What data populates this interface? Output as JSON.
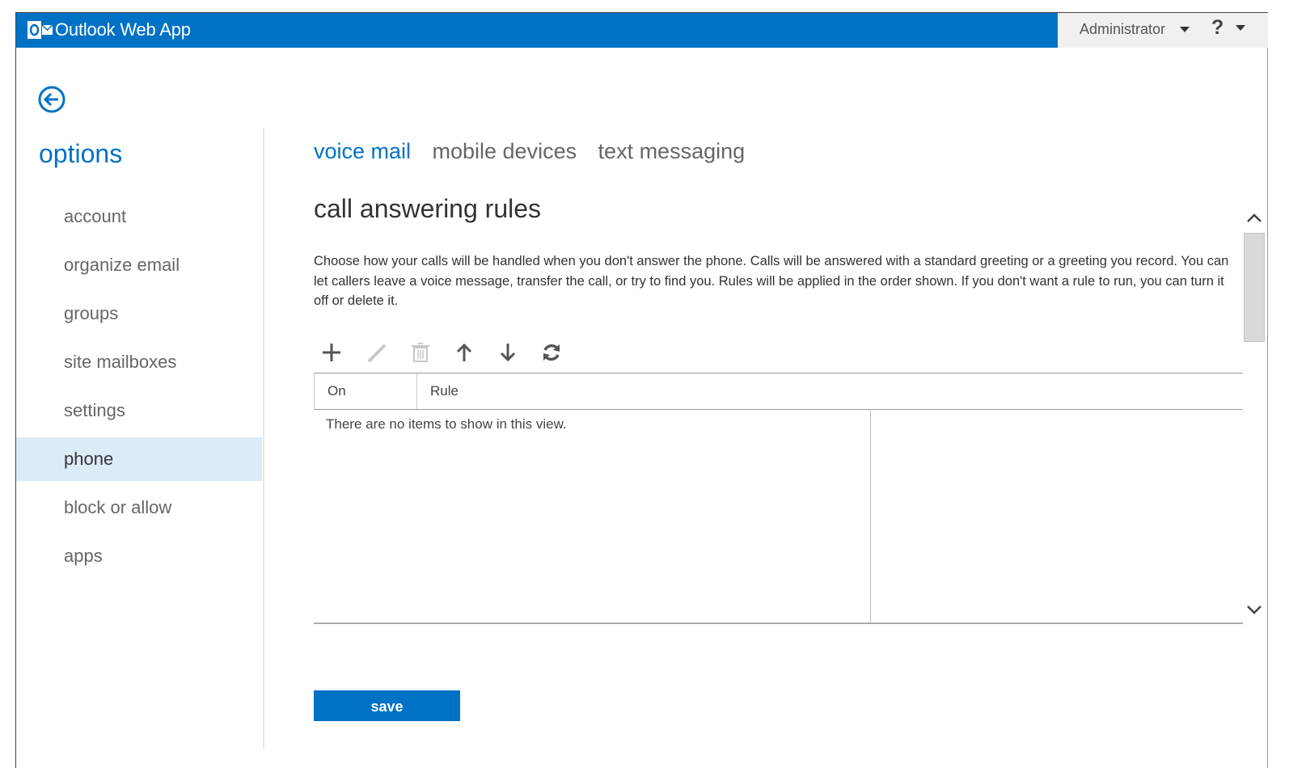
{
  "app": {
    "title": "Outlook Web App"
  },
  "user": {
    "name": "Administrator",
    "help_label": "?"
  },
  "sidebar": {
    "title": "options",
    "items": [
      {
        "label": "account"
      },
      {
        "label": "organize email"
      },
      {
        "label": "groups"
      },
      {
        "label": "site mailboxes"
      },
      {
        "label": "settings"
      },
      {
        "label": "phone",
        "selected": true
      },
      {
        "label": "block or allow"
      },
      {
        "label": "apps"
      }
    ]
  },
  "tabs": [
    {
      "label": "voice mail",
      "active": true
    },
    {
      "label": "mobile devices"
    },
    {
      "label": "text messaging"
    }
  ],
  "main": {
    "section_title": "call answering rules",
    "description": "Choose how your calls will be handled when you don't answer the phone. Calls will be answered with a standard greeting or a greeting you record. You can let callers leave a voice message, transfer the call, or try to find you. Rules will be applied in the order shown. If you don't want a rule to run, you can turn it off or delete it.",
    "toolbar": {
      "icons": [
        "add-icon",
        "edit-icon",
        "delete-icon",
        "move-up-icon",
        "move-down-icon",
        "refresh-icon"
      ]
    },
    "table": {
      "columns": [
        "On",
        "Rule"
      ],
      "empty_message": "There are no items to show in this view."
    },
    "save_label": "save"
  },
  "colors": {
    "accent": "#0072c6",
    "selected_bg": "#dcebf8",
    "disabled_icon": "#c8c8c8"
  }
}
